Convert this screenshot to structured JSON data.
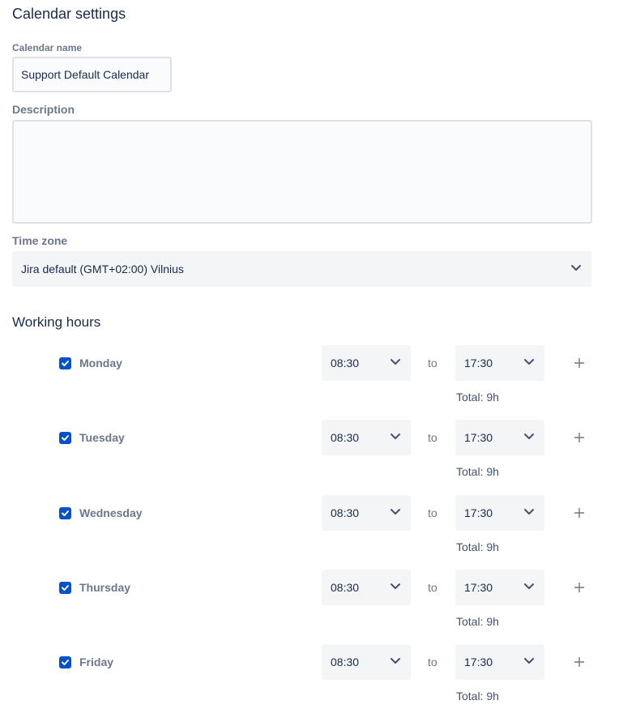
{
  "page": {
    "title": "Calendar settings"
  },
  "form": {
    "calendar_name_label": "Calendar name",
    "calendar_name_value": "Support Default Calendar",
    "description_label": "Description",
    "description_value": "",
    "timezone_label": "Time zone",
    "timezone_value": "Jira default (GMT+02:00) Vilnius"
  },
  "working_hours": {
    "title": "Working hours",
    "to_label": "to",
    "days": [
      {
        "name": "Monday",
        "checked": true,
        "from": "08:30",
        "to": "17:30",
        "total": "Total: 9h"
      },
      {
        "name": "Tuesday",
        "checked": true,
        "from": "08:30",
        "to": "17:30",
        "total": "Total: 9h"
      },
      {
        "name": "Wednesday",
        "checked": true,
        "from": "08:30",
        "to": "17:30",
        "total": "Total: 9h"
      },
      {
        "name": "Thursday",
        "checked": true,
        "from": "08:30",
        "to": "17:30",
        "total": "Total: 9h"
      },
      {
        "name": "Friday",
        "checked": true,
        "from": "08:30",
        "to": "17:30",
        "total": "Total: 9h"
      }
    ]
  },
  "colors": {
    "accent": "#0052cc",
    "text": "#172b4d",
    "subtle": "#6b778c",
    "field_bg": "#f4f5f7"
  },
  "icons": {
    "checkbox": "check-icon",
    "dropdown": "chevron-down-icon",
    "add": "plus-icon"
  }
}
